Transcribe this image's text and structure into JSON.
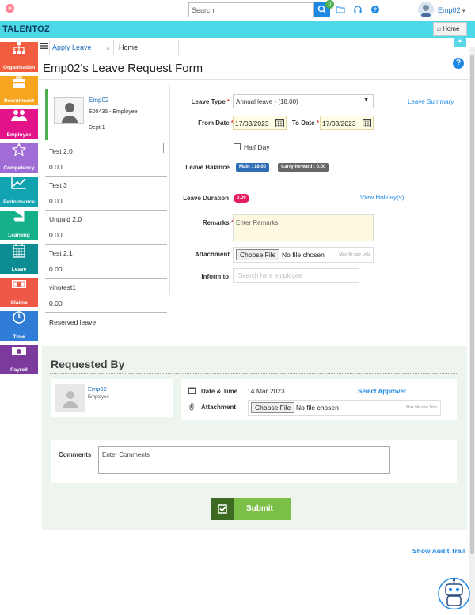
{
  "topbar": {
    "search_placeholder": "Search",
    "notification_count": "0",
    "user_name": "Emp02"
  },
  "brand": {
    "name": "TALENTOZ",
    "home_label": "Home"
  },
  "sidebar": {
    "items": [
      {
        "label": "Organisation",
        "color": "#f25c3f",
        "icon": "org-chart-icon"
      },
      {
        "label": "Recruitment",
        "color": "#f7a51f",
        "icon": "briefcase-icon"
      },
      {
        "label": "Employee",
        "color": "#e3148a",
        "icon": "people-icon"
      },
      {
        "label": "Competency",
        "color": "#a06cd5",
        "icon": "star-icon"
      },
      {
        "label": "Performance",
        "color": "#11a3b0",
        "icon": "trend-chart-icon"
      },
      {
        "label": "Learning",
        "color": "#14b08a",
        "icon": "book-icon"
      },
      {
        "label": "Leave",
        "color": "#0e8c93",
        "icon": "calendar-icon"
      },
      {
        "label": "Claims",
        "color": "#ef5847",
        "icon": "money-icon"
      },
      {
        "label": "Time",
        "color": "#2f7dd7",
        "icon": "clock-icon"
      },
      {
        "label": "Payroll",
        "color": "#7c3a9c",
        "icon": "payroll-icon"
      }
    ]
  },
  "tabs": {
    "active_label": "Apply Leave",
    "close_glyph": "×",
    "home_label": "Home"
  },
  "page": {
    "title": "Emp02's Leave Request Form",
    "help": "?"
  },
  "employee": {
    "name": "Emp02",
    "code": "E00436 - Employee",
    "dept": "Dept 1"
  },
  "leave_types": [
    {
      "name": "Test 2.0",
      "value": "0.00"
    },
    {
      "name": "Test 3",
      "value": "0.00"
    },
    {
      "name": "Unpaid 2.0",
      "value": "0.00"
    },
    {
      "name": "Test 2.1",
      "value": "0.00"
    },
    {
      "name": "vinotest1",
      "value": "0.00"
    },
    {
      "name": "Reserved leave",
      "value": ""
    }
  ],
  "form": {
    "leave_type_label": "Leave Type",
    "leave_type_value": "Annual leave - (18.00)",
    "leave_summary_link": "Leave Summary",
    "from_date_label": "From Date",
    "from_date_value": "17/03/2023",
    "to_date_label": "To Date",
    "to_date_value": "17/03/2023",
    "half_day_label": "Half Day",
    "leave_balance_label": "Leave Balance",
    "main_balance": "Main : 18.00",
    "carry_forward": "Carry forward : 0.00",
    "leave_duration_label": "Leave Duration",
    "leave_duration_value": "0.00",
    "view_holidays_link": "View Holiday(s)",
    "remarks_label": "Remarks",
    "remarks_placeholder": "Enter Remarks",
    "attachment_label": "Attachment",
    "choose_file": "Choose File",
    "no_file": "No file chosen",
    "max_file_size": "Max file size 1mb",
    "inform_to_label": "Inform to",
    "inform_placeholder": "Search here employee",
    "required_mark": "*"
  },
  "requested_by": {
    "title": "Requested By",
    "name": "Emp02",
    "role": "Employee",
    "date_time_label": "Date & Time",
    "date_time_value": "14 Mar 2023",
    "select_approver": "Select Approver",
    "attachment_label": "Attachment",
    "choose_file": "Choose File",
    "no_file": "No file chosen",
    "max_file_size": "Max file size 1mb",
    "comments_label": "Comments",
    "comments_placeholder": "Enter Comments",
    "submit_label": "Submit"
  },
  "footer": {
    "audit_trail": "Show Audit Trail"
  }
}
